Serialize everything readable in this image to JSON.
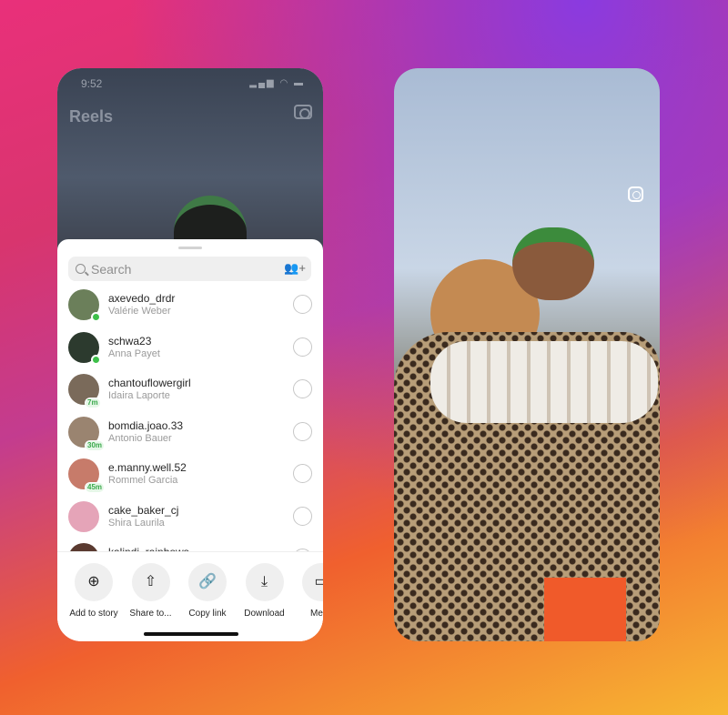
{
  "left_phone": {
    "status_time": "9:52",
    "header_title": "Reels",
    "search": {
      "placeholder": "Search"
    },
    "contacts": [
      {
        "username": "axevedo_drdr",
        "name": "Valérie Weber",
        "status": "online",
        "avatar_color": "#6b7f5a"
      },
      {
        "username": "schwa23",
        "name": "Anna Payet",
        "status": "online",
        "avatar_color": "#2c3a2e"
      },
      {
        "username": "chantouflowergirl",
        "name": "Idaira Laporte",
        "status": "7m",
        "avatar_color": "#7a6a5a"
      },
      {
        "username": "bomdia.joao.33",
        "name": "Antonio Bauer",
        "status": "30m",
        "avatar_color": "#9a8470"
      },
      {
        "username": "e.manny.well.52",
        "name": "Rommel Garcia",
        "status": "45m",
        "avatar_color": "#c77b6a"
      },
      {
        "username": "cake_baker_cj",
        "name": "Shira Laurila",
        "status": "",
        "avatar_color": "#e5a4b8"
      },
      {
        "username": "kalindi_rainbows",
        "name": "",
        "status": "",
        "avatar_color": "#5a3a30"
      }
    ],
    "actions": [
      {
        "label": "Add to story",
        "icon": "add-story-icon",
        "glyph": "⊕"
      },
      {
        "label": "Share to...",
        "icon": "share-icon",
        "glyph": "⇧"
      },
      {
        "label": "Copy link",
        "icon": "link-icon",
        "glyph": "🔗"
      },
      {
        "label": "Download",
        "icon": "download-icon",
        "glyph": "⤓"
      },
      {
        "label": "Mess",
        "icon": "message-icon",
        "glyph": "▭"
      }
    ]
  },
  "colors": {
    "online": "#3ec04a",
    "accent": "#e9307a"
  }
}
